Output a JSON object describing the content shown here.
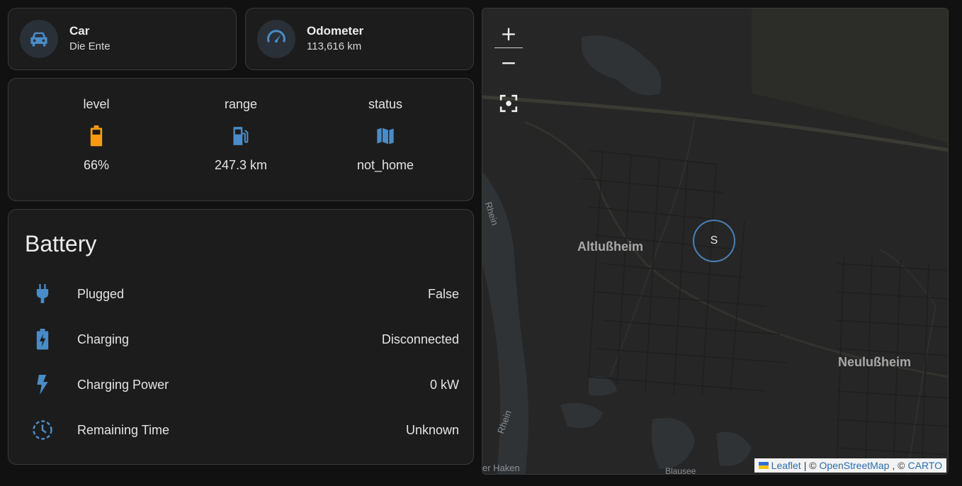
{
  "tiles": {
    "car": {
      "name": "Car",
      "state": "Die Ente",
      "icon": "car-icon"
    },
    "odometer": {
      "name": "Odometer",
      "state": "113,616 km",
      "icon": "speedometer-icon"
    }
  },
  "glance": {
    "items": [
      {
        "name": "level",
        "state": "66%",
        "icon": "battery-icon",
        "color": "#f39c12"
      },
      {
        "name": "range",
        "state": "247.3 km",
        "icon": "fuel-pump-icon",
        "color": "#4a8cc7"
      },
      {
        "name": "status",
        "state": "not_home",
        "icon": "map-icon",
        "color": "#4a8cc7"
      }
    ]
  },
  "battery": {
    "title": "Battery",
    "rows": [
      {
        "label": "Plugged",
        "value": "False",
        "icon": "power-plug-icon"
      },
      {
        "label": "Charging",
        "value": "Disconnected",
        "icon": "battery-charging-icon"
      },
      {
        "label": "Charging Power",
        "value": "0 kW",
        "icon": "flash-icon"
      },
      {
        "label": "Remaining Time",
        "value": "Unknown",
        "icon": "clock-icon"
      }
    ]
  },
  "map": {
    "zoom_in": "+",
    "zoom_out": "−",
    "labels": [
      "Altlußheim",
      "Neulußheim",
      "Rhein",
      "Rhein",
      "er Haken",
      "Blausee"
    ],
    "marker": "S",
    "attribution": {
      "leaflet": "Leaflet",
      "sep1": "| ©",
      "osm": "OpenStreetMap",
      "sep2": ", ©",
      "carto": "CARTO"
    }
  },
  "colors": {
    "icon_blue": "#4a8cc7",
    "accent_orange": "#f39c12",
    "card_bg": "#1c1c1c"
  }
}
